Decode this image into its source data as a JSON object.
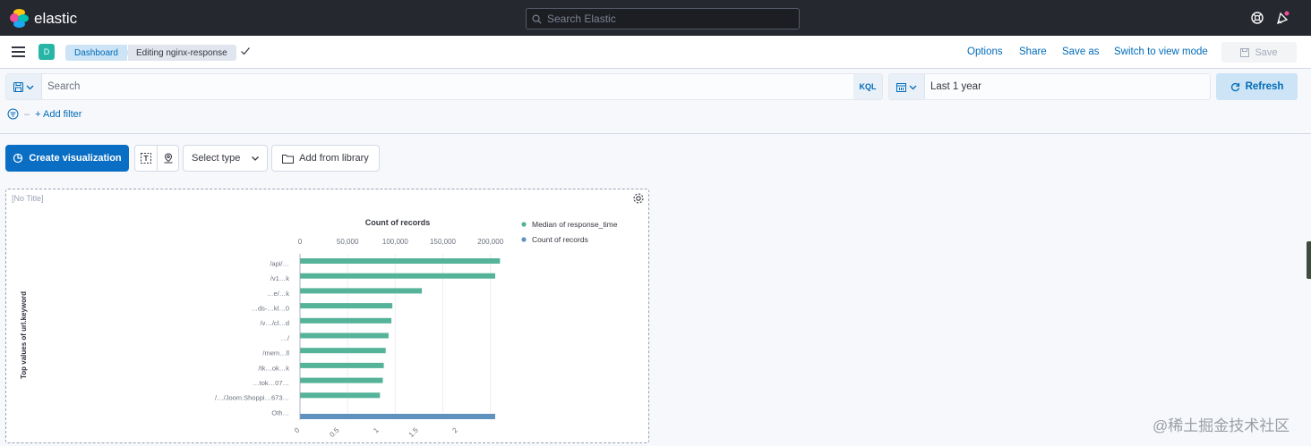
{
  "app": {
    "brand": "elastic",
    "search_placeholder": "Search Elastic"
  },
  "header": {
    "space_initial": "D",
    "breadcrumbs": [
      "Dashboard",
      "Editing nginx-response"
    ],
    "links": {
      "options": "Options",
      "share": "Share",
      "save_as": "Save as",
      "switch_mode": "Switch to view mode"
    },
    "save_label": "Save"
  },
  "query": {
    "placeholder": "Search",
    "language": "KQL",
    "date_range": "Last 1 year",
    "refresh_label": "Refresh",
    "add_filter": "+ Add filter"
  },
  "toolbar": {
    "create_label": "Create visualization",
    "select_type": "Select type",
    "add_from_library": "Add from library"
  },
  "panel": {
    "title": "[No Title]"
  },
  "chart_data": {
    "type": "bar",
    "orientation": "horizontal",
    "title": "Count of records",
    "ylabel": "Top values of url.keyword",
    "legend_position": "top-right",
    "top_axis": {
      "ticks": [
        0,
        50000,
        100000,
        150000,
        200000
      ],
      "tick_labels": [
        "0",
        "50,000",
        "100,000",
        "150,000",
        "200,000"
      ],
      "range": [
        0,
        205000
      ]
    },
    "bottom_axis": {
      "ticks": [
        0,
        0.5,
        1,
        1.5,
        2
      ],
      "tick_labels": [
        "0",
        "0.5",
        "1",
        "1.5",
        "2"
      ],
      "range": [
        0,
        2.47
      ]
    },
    "categories": [
      "/api/…",
      "/v1…k",
      "…e/…k",
      "…ds-…kl…0",
      "/v…/cl…d",
      "…/",
      "/mem…ll",
      "/tk…ok…k",
      "…tok…07…",
      "/…/Joom.Shoppi…673…",
      "Oth…"
    ],
    "series": [
      {
        "name": "Median of response_time",
        "axis": "bottom",
        "values": [
          0,
          0,
          0,
          0,
          0,
          0,
          0,
          0,
          0,
          0,
          2.47
        ]
      },
      {
        "name": "Count of records",
        "axis": "top",
        "values": [
          210000,
          205000,
          128000,
          97000,
          96000,
          93000,
          90000,
          88000,
          87000,
          84000,
          0
        ]
      }
    ],
    "colors": {
      "count": "#54b399",
      "median": "#6092c0"
    }
  }
}
